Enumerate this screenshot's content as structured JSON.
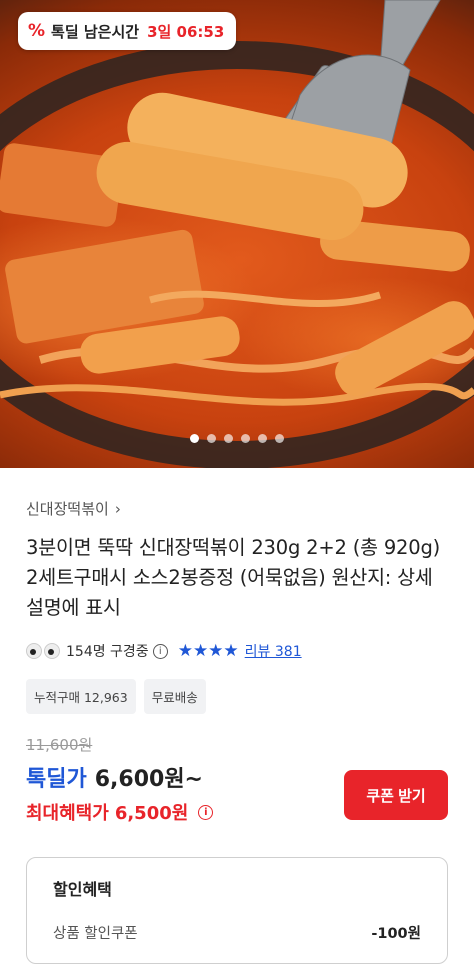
{
  "timer": {
    "icon": "percent-icon",
    "label": "톡딜 남은시간",
    "time": "3일 06:53"
  },
  "carousel": {
    "total": 6,
    "active": 0
  },
  "product": {
    "brand": "신대장떡볶이",
    "title": "3분이면 뚝딱 신대장떡볶이 230g 2+2 (총 920g) 2세트구매시 소스2봉증정 (어묵없음) 원산지: 상세설명에 표시"
  },
  "stats": {
    "viewers": "154명 구경중",
    "rating_stars": "★★★★",
    "reviews": "리뷰 381"
  },
  "tags": [
    "누적구매 12,963",
    "무료배송"
  ],
  "price": {
    "original": "11,600원",
    "deal_label": "톡딜가",
    "deal_value": "6,600원~",
    "max_label": "최대혜택가",
    "max_value": "6,500원",
    "coupon_button": "쿠폰 받기"
  },
  "benefit": {
    "title": "할인혜택",
    "row_label": "상품 할인쿠폰",
    "row_value": "-100원"
  },
  "colors": {
    "accent_red": "#e8242a",
    "accent_blue": "#1f57d6"
  }
}
